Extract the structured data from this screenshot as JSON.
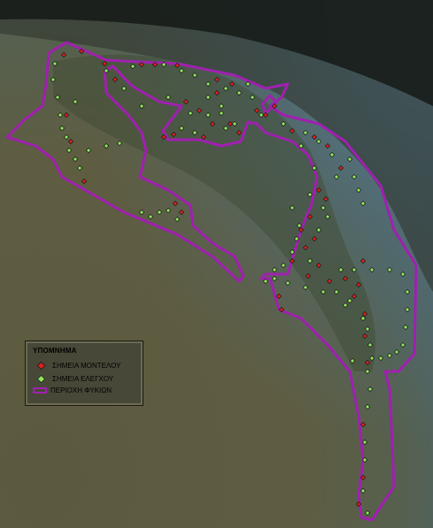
{
  "legend": {
    "title": "ΥΠΟΜΝΗΜΑ",
    "items": [
      {
        "label": "ΣΗΜΕΙΑ ΜΟΝΤΕΛΟΥ",
        "symbol": "red-diamond",
        "color": "#e0201a"
      },
      {
        "label": "ΣΗΜΕΙΑ ΕΛΕΓΧΟΥ",
        "symbol": "green-diamond",
        "color": "#8ee85a"
      },
      {
        "label": "ΠΕΡΙΟΧΗ ΦΥΚΙΩΝ",
        "symbol": "purple-outline",
        "color": "#a020b0"
      }
    ]
  },
  "colors": {
    "land": "#5a5a40",
    "water": "#4a6a7a",
    "region_outline": "#a020b0",
    "model_point": "#e0201a",
    "control_point": "#8ee85a"
  }
}
